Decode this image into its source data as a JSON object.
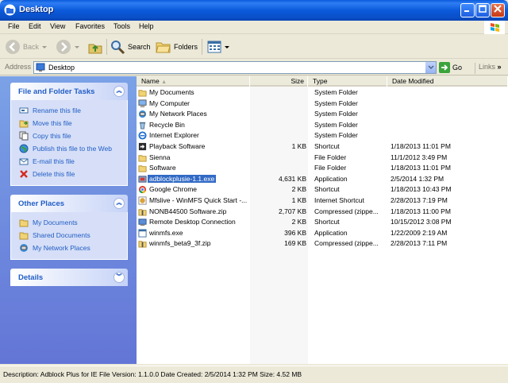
{
  "window": {
    "title": "Desktop"
  },
  "menu": [
    "File",
    "Edit",
    "View",
    "Favorites",
    "Tools",
    "Help"
  ],
  "toolbar": {
    "back": "Back",
    "search": "Search",
    "folders": "Folders"
  },
  "address": {
    "label": "Address",
    "value": "Desktop",
    "go": "Go",
    "links": "Links"
  },
  "tasks_panel": {
    "title": "File and Folder Tasks",
    "items": [
      "Rename this file",
      "Move this file",
      "Copy this file",
      "Publish this file to the Web",
      "E-mail this file",
      "Delete this file"
    ]
  },
  "places_panel": {
    "title": "Other Places",
    "items": [
      "My Documents",
      "Shared Documents",
      "My Network Places"
    ]
  },
  "details_panel": {
    "title": "Details"
  },
  "columns": {
    "name": "Name",
    "size": "Size",
    "type": "Type",
    "modified": "Date Modified"
  },
  "files": [
    {
      "name": "My Documents",
      "size": "",
      "type": "System Folder",
      "modified": "",
      "icon": "folder-icon"
    },
    {
      "name": "My Computer",
      "size": "",
      "type": "System Folder",
      "modified": "",
      "icon": "computer-icon"
    },
    {
      "name": "My Network Places",
      "size": "",
      "type": "System Folder",
      "modified": "",
      "icon": "network-icon"
    },
    {
      "name": "Recycle Bin",
      "size": "",
      "type": "System Folder",
      "modified": "",
      "icon": "recycle-bin-icon"
    },
    {
      "name": "Internet Explorer",
      "size": "",
      "type": "System Folder",
      "modified": "",
      "icon": "ie-icon"
    },
    {
      "name": "Playback Software",
      "size": "1 KB",
      "type": "Shortcut",
      "modified": "1/18/2013 11:01 PM",
      "icon": "shortcut-icon"
    },
    {
      "name": "Sienna",
      "size": "",
      "type": "File Folder",
      "modified": "11/1/2012 3:49 PM",
      "icon": "folder-icon"
    },
    {
      "name": "Software",
      "size": "",
      "type": "File Folder",
      "modified": "1/18/2013 11:01 PM",
      "icon": "folder-icon"
    },
    {
      "name": "adblockplusie-1.1.exe",
      "size": "4,631 KB",
      "type": "Application",
      "modified": "2/5/2014 1:32 PM",
      "icon": "installer-icon",
      "selected": true
    },
    {
      "name": "Google Chrome",
      "size": "2 KB",
      "type": "Shortcut",
      "modified": "1/18/2013 10:43 PM",
      "icon": "chrome-icon"
    },
    {
      "name": "Mfslive - WinMFS Quick Start -...",
      "size": "1 KB",
      "type": "Internet Shortcut",
      "modified": "2/28/2013 7:19 PM",
      "icon": "internet-shortcut-icon"
    },
    {
      "name": "NONB44500 Software.zip",
      "size": "2,707 KB",
      "type": "Compressed (zippe...",
      "modified": "1/18/2013 11:00 PM",
      "icon": "zip-icon"
    },
    {
      "name": "Remote Desktop Connection",
      "size": "2 KB",
      "type": "Shortcut",
      "modified": "10/15/2012 3:08 PM",
      "icon": "remote-desktop-icon"
    },
    {
      "name": "winmfs.exe",
      "size": "396 KB",
      "type": "Application",
      "modified": "1/22/2009 2:19 AM",
      "icon": "app-icon"
    },
    {
      "name": "winmfs_beta9_3f.zip",
      "size": "169 KB",
      "type": "Compressed (zippe...",
      "modified": "2/28/2013 7:11 PM",
      "icon": "zip-icon"
    }
  ],
  "status": {
    "text": "Description: Adblock Plus for IE File Version: 1.1.0.0 Date Created: 2/5/2014 1:32 PM Size: 4.52 MB"
  }
}
